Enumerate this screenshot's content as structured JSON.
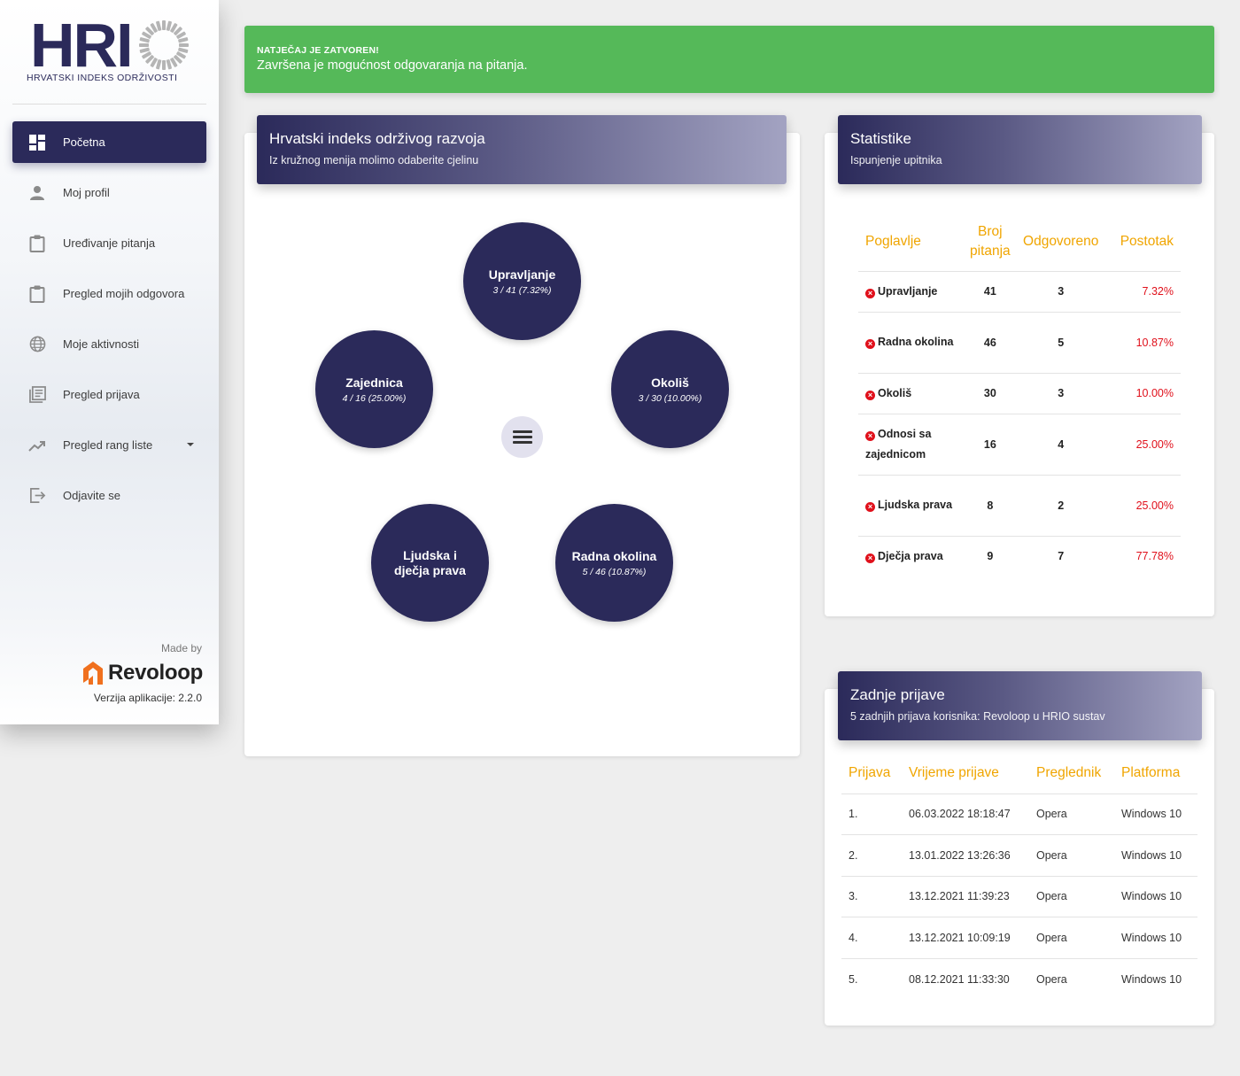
{
  "brand": {
    "logo_text": "HRI",
    "logo_subtitle": "HRVATSKI INDEKS ODRŽIVOSTI",
    "made_by": "Made by",
    "company": "Revoloop",
    "version": "Verzija aplikacije: 2.2.0",
    "colors": {
      "primary": "#2b2a5a",
      "success": "#55b959",
      "accent": "#f0a500",
      "danger": "#e0101b",
      "revoloop_orange": "#f0701e"
    }
  },
  "sidebar": {
    "items": [
      {
        "label": "Početna",
        "icon": "dashboard-icon",
        "active": true
      },
      {
        "label": "Moj profil",
        "icon": "person-icon"
      },
      {
        "label": "Uređivanje pitanja",
        "icon": "clipboard-icon"
      },
      {
        "label": "Pregled mojih odgovora",
        "icon": "clipboard-icon"
      },
      {
        "label": "Moje aktivnosti",
        "icon": "globe-icon"
      },
      {
        "label": "Pregled prijava",
        "icon": "list-icon"
      },
      {
        "label": "Pregled rang liste",
        "icon": "trending-icon",
        "has_dropdown": true
      },
      {
        "label": "Odjavite se",
        "icon": "logout-icon"
      }
    ]
  },
  "alert": {
    "title": "NATJEČAJ JE ZATVOREN!",
    "message": "Završena je mogućnost odgovaranja na pitanja."
  },
  "index_card": {
    "title": "Hrvatski indeks održivog razvoja",
    "subtitle": "Iz kružnog menija molimo odaberite cjelinu",
    "menu_icon": "hamburger-menu-icon",
    "circles": [
      {
        "name": "Upravljanje",
        "stat": "3 / 41 (7.32%)"
      },
      {
        "name": "Zajednica",
        "stat": "4 / 16 (25.00%)"
      },
      {
        "name": "Okoliš",
        "stat": "3 / 30 (10.00%)"
      },
      {
        "name": "Ljudska i dječja prava",
        "stat": ""
      },
      {
        "name": "Radna okolina",
        "stat": "5 / 46 (10.87%)"
      }
    ]
  },
  "stats_card": {
    "title": "Statistike",
    "subtitle": "Ispunjenje upitnika",
    "headers": [
      "Poglavlje",
      "Broj pitanja",
      "Odgovoreno",
      "Postotak"
    ],
    "rows": [
      {
        "chapter": "Upravljanje",
        "questions": "41",
        "answered": "3",
        "percent": "7.32%"
      },
      {
        "chapter": "Radna okolina",
        "questions": "46",
        "answered": "5",
        "percent": "10.87%"
      },
      {
        "chapter": "Okoliš",
        "questions": "30",
        "answered": "3",
        "percent": "10.00%"
      },
      {
        "chapter": "Odnosi sa zajednicom",
        "questions": "16",
        "answered": "4",
        "percent": "25.00%"
      },
      {
        "chapter": "Ljudska prava",
        "questions": "8",
        "answered": "2",
        "percent": "25.00%"
      },
      {
        "chapter": "Dječja prava",
        "questions": "9",
        "answered": "7",
        "percent": "77.78%"
      }
    ]
  },
  "logins_card": {
    "title": "Zadnje prijave",
    "subtitle": "5 zadnjih prijava korisnika: Revoloop u HRIO sustav",
    "headers": [
      "Prijava",
      "Vrijeme prijave",
      "Preglednik",
      "Platforma"
    ],
    "rows": [
      {
        "n": "1.",
        "time": "06.03.2022 18:18:47",
        "browser": "Opera",
        "platform": "Windows 10"
      },
      {
        "n": "2.",
        "time": "13.01.2022 13:26:36",
        "browser": "Opera",
        "platform": "Windows 10"
      },
      {
        "n": "3.",
        "time": "13.12.2021 11:39:23",
        "browser": "Opera",
        "platform": "Windows 10"
      },
      {
        "n": "4.",
        "time": "13.12.2021 10:09:19",
        "browser": "Opera",
        "platform": "Windows 10"
      },
      {
        "n": "5.",
        "time": "08.12.2021 11:33:30",
        "browser": "Opera",
        "platform": "Windows 10"
      }
    ]
  }
}
